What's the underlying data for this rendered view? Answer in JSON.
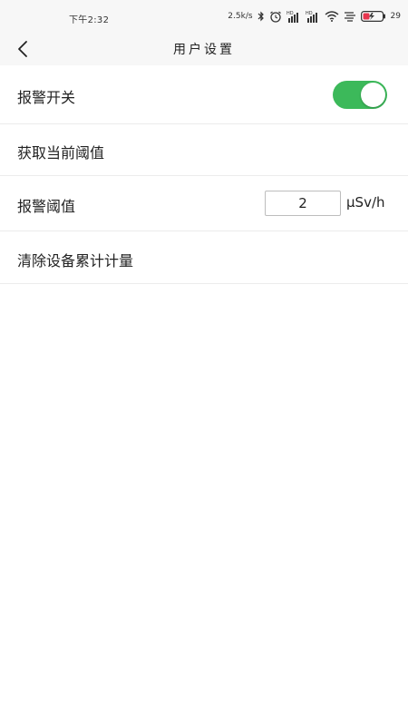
{
  "status_bar": {
    "time": "下午2:32",
    "network_speed": "2.5k/s",
    "battery": "29",
    "colors": {
      "battery_low": "#e8344e"
    },
    "icons": [
      "bluetooth-icon",
      "alarm-icon",
      "signal-hd-icon",
      "signal-hd-icon",
      "wifi-icon",
      "data-saver-icon",
      "battery-charging-icon"
    ]
  },
  "header": {
    "back_icon": "chevron-left-icon",
    "title": "用户设置"
  },
  "settings": {
    "alarm_switch": {
      "label": "报警开关",
      "enabled": true,
      "color": "#3cb95a"
    },
    "get_threshold": {
      "label": "获取当前阈值"
    },
    "alarm_threshold": {
      "label": "报警阈值",
      "value": "2",
      "unit": "μSv/h"
    },
    "clear_dose": {
      "label": "清除设备累计计量"
    }
  }
}
